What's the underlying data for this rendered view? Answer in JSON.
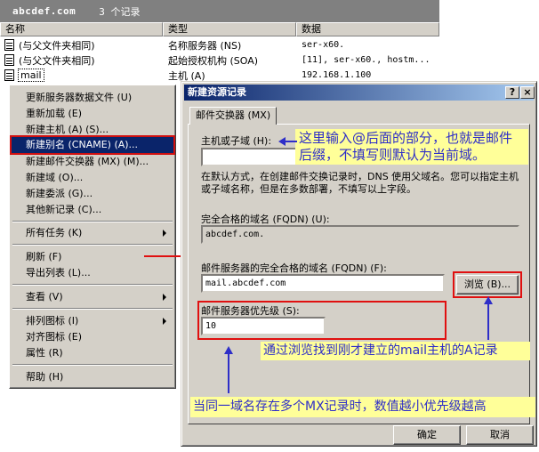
{
  "window": {
    "domain": "abcdef.com",
    "record_count": "3 个记录"
  },
  "columns": [
    "名称",
    "类型",
    "数据"
  ],
  "rows": [
    {
      "name": "(与父文件夹相同)",
      "type": "名称服务器 (NS)",
      "data": "ser-x60."
    },
    {
      "name": "(与父文件夹相同)",
      "type": "起始授权机构 (SOA)",
      "data": "[11], ser-x60., hostm..."
    },
    {
      "name": "mail",
      "type": "主机 (A)",
      "data": "192.168.1.100"
    }
  ],
  "context_menu": {
    "items": [
      "更新服务器数据文件 (U)",
      "重新加载 (E)",
      "新建主机 (A) (S)...",
      "新建别名 (CNAME) (A)...",
      "新建邮件交换器 (MX) (M)...",
      "新建域 (O)...",
      "新建委派 (G)...",
      "其他新记录 (C)...",
      "所有任务 (K)",
      "刷新 (F)",
      "导出列表 (L)...",
      "查看 (V)",
      "排列图标 (I)",
      "对齐图标 (E)",
      "属性 (R)",
      "帮助 (H)"
    ]
  },
  "dialog": {
    "title": "新建资源记录",
    "help_btn": "?",
    "close_btn": "×",
    "tab": "邮件交换器 (MX)",
    "host_label": "主机或子域 (H):",
    "host_value": "",
    "desc": "在默认方式，在创建邮件交换记录时，DNS 使用父域名。您可以指定主机或子域名称，但是在多数部署，不填写以上字段。",
    "fqdn_label": "完全合格的域名 (FQDN) (U):",
    "fqdn_value": "abcdef.com.",
    "mailserver_label": "邮件服务器的完全合格的域名 (FQDN) (F):",
    "mailserver_value": "mail.abcdef.com",
    "browse_btn": "浏览 (B)...",
    "priority_label": "邮件服务器优先级 (S):",
    "priority_value": "10",
    "ok_btn": "确定",
    "cancel_btn": "取消"
  },
  "annotations": {
    "note1": "这里输入@后面的部分，也就是邮件后缀，不填写则默认为当前域。",
    "note2": "通过浏览找到刚才建立的mail主机的A记录",
    "note3": "当同一域名存在多个MX记录时，数值越小优先级越高"
  },
  "colors": {
    "title_blue": "#0a246a",
    "annot_red": "#e01010",
    "annot_blue": "#2e2ec8",
    "note_bg": "#ffff99"
  }
}
